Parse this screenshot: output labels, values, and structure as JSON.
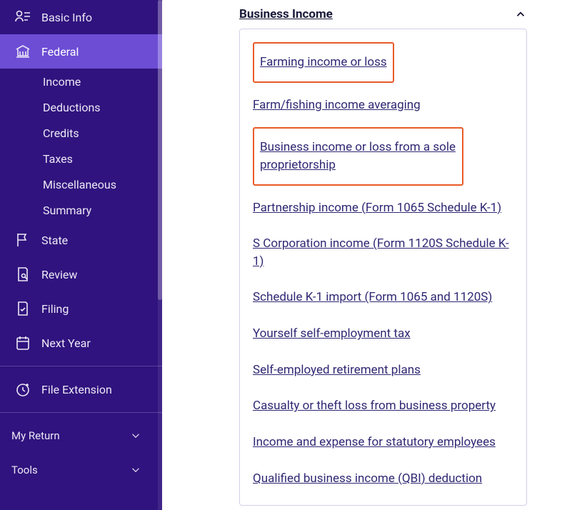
{
  "sidebar": {
    "nav": [
      {
        "key": "basic-info",
        "label": "Basic Info"
      },
      {
        "key": "federal",
        "label": "Federal"
      },
      {
        "key": "state",
        "label": "State"
      },
      {
        "key": "review",
        "label": "Review"
      },
      {
        "key": "filing",
        "label": "Filing"
      },
      {
        "key": "next-year",
        "label": "Next Year"
      }
    ],
    "federal_sub": [
      "Income",
      "Deductions",
      "Credits",
      "Taxes",
      "Miscellaneous",
      "Summary"
    ],
    "file_extension": "File Extension",
    "bottom": [
      "My Return",
      "Tools"
    ]
  },
  "main": {
    "section_title": "Business Income",
    "links": [
      "Farming income or loss",
      "Farm/fishing income averaging",
      "Business income or loss from a sole proprietorship",
      "Partnership income (Form 1065 Schedule K-1)",
      "S Corporation income (Form 1120S Schedule K-1)",
      "Schedule K-1 import (Form 1065 and 1120S)",
      "Yourself self-employment tax",
      "Self-employed retirement plans",
      "Casualty or theft loss from business property",
      "Income and expense for statutory employees",
      "Qualified business income (QBI) deduction"
    ]
  }
}
